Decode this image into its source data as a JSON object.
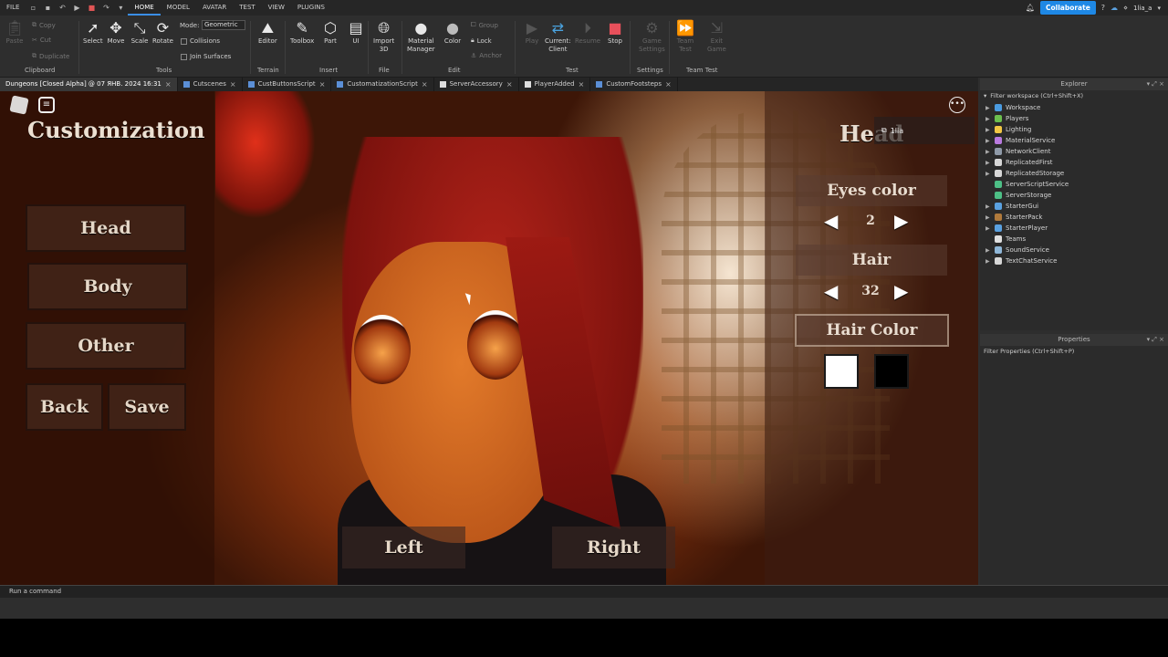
{
  "menu": {
    "file": "FILE",
    "tabs": [
      "HOME",
      "MODEL",
      "AVATAR",
      "TEST",
      "VIEW",
      "PLUGINS"
    ],
    "active_tab": "HOME",
    "collaborate": "Collaborate",
    "user": "1lia_a"
  },
  "ribbon": {
    "clipboard": {
      "paste": "Paste",
      "copy": "Copy",
      "cut": "Cut",
      "duplicate": "Duplicate",
      "group": "Clipboard"
    },
    "tools": {
      "select": "Select",
      "move": "Move",
      "scale": "Scale",
      "rotate": "Rotate",
      "group": "Tools"
    },
    "mode": {
      "label": "Mode:",
      "value": "Geometric",
      "collisions": "Collisions",
      "join_surfaces": "Join Surfaces"
    },
    "terrain": {
      "editor": "Editor",
      "group": "Terrain"
    },
    "insert": {
      "toolbox": "Toolbox",
      "part": "Part",
      "ui": "UI",
      "group": "Insert"
    },
    "file": {
      "import3d_1": "Import",
      "import3d_2": "3D",
      "group": "File"
    },
    "edit": {
      "material_1": "Material",
      "material_2": "Manager",
      "color": "Color",
      "group_btn": "Group",
      "lock": "Lock",
      "anchor": "Anchor",
      "group": "Edit"
    },
    "test": {
      "play": "Play",
      "current_client_1": "Current:",
      "current_client_2": "Client",
      "resume": "Resume",
      "stop": "Stop",
      "group": "Test"
    },
    "settings": {
      "game_1": "Game",
      "game_2": "Settings",
      "group": "Settings"
    },
    "team_test": {
      "team_1": "Team",
      "team_2": "Test",
      "exit_1": "Exit",
      "exit_2": "Game",
      "group": "Team Test"
    }
  },
  "doc_tabs": [
    {
      "label": "Dungeons [Closed Alpha] @ 07 ЯНВ. 2024 16:31"
    },
    {
      "label": "Cutscenes"
    },
    {
      "label": "CustButtonsScript"
    },
    {
      "label": "CustomatizationScript"
    },
    {
      "label": "ServerAccessory"
    },
    {
      "label": "PlayerAdded"
    },
    {
      "label": "CustomFootsteps"
    }
  ],
  "game": {
    "title": "Customization",
    "menu_buttons": [
      "Head",
      "Body",
      "Other"
    ],
    "back": "Back",
    "save": "Save",
    "section_title": "Head",
    "player_name": "1lia",
    "eyes_color_label": "Eyes color",
    "eyes_color_value": "2",
    "hair_label": "Hair",
    "hair_value": "32",
    "hair_color_label": "Hair Color",
    "hair_swatches": [
      "#ffffff",
      "#000000"
    ],
    "left": "Left",
    "right": "Right"
  },
  "explorer": {
    "title": "Explorer",
    "filter": "Filter workspace (Ctrl+Shift+X)",
    "items": [
      {
        "label": "Workspace",
        "color": "#4a9be0"
      },
      {
        "label": "Players",
        "color": "#6cbf4e"
      },
      {
        "label": "Lighting",
        "color": "#f2c744"
      },
      {
        "label": "MaterialService",
        "color": "#b97adf"
      },
      {
        "label": "NetworkClient",
        "color": "#8f9aa8"
      },
      {
        "label": "ReplicatedFirst",
        "color": "#d7d7d7"
      },
      {
        "label": "ReplicatedStorage",
        "color": "#d7d7d7"
      },
      {
        "label": "ServerScriptService",
        "color": "#4dbf86"
      },
      {
        "label": "ServerStorage",
        "color": "#4dbf86"
      },
      {
        "label": "StarterGui",
        "color": "#5aa1e0"
      },
      {
        "label": "StarterPack",
        "color": "#b07a3c"
      },
      {
        "label": "StarterPlayer",
        "color": "#5aa1e0"
      },
      {
        "label": "Teams",
        "color": "#e0e0e0"
      },
      {
        "label": "SoundService",
        "color": "#8fb7d8"
      },
      {
        "label": "TextChatService",
        "color": "#d7d7d7"
      }
    ]
  },
  "properties": {
    "title": "Properties",
    "filter": "Filter Properties (Ctrl+Shift+P)"
  },
  "command_bar": {
    "placeholder": "Run a command"
  }
}
